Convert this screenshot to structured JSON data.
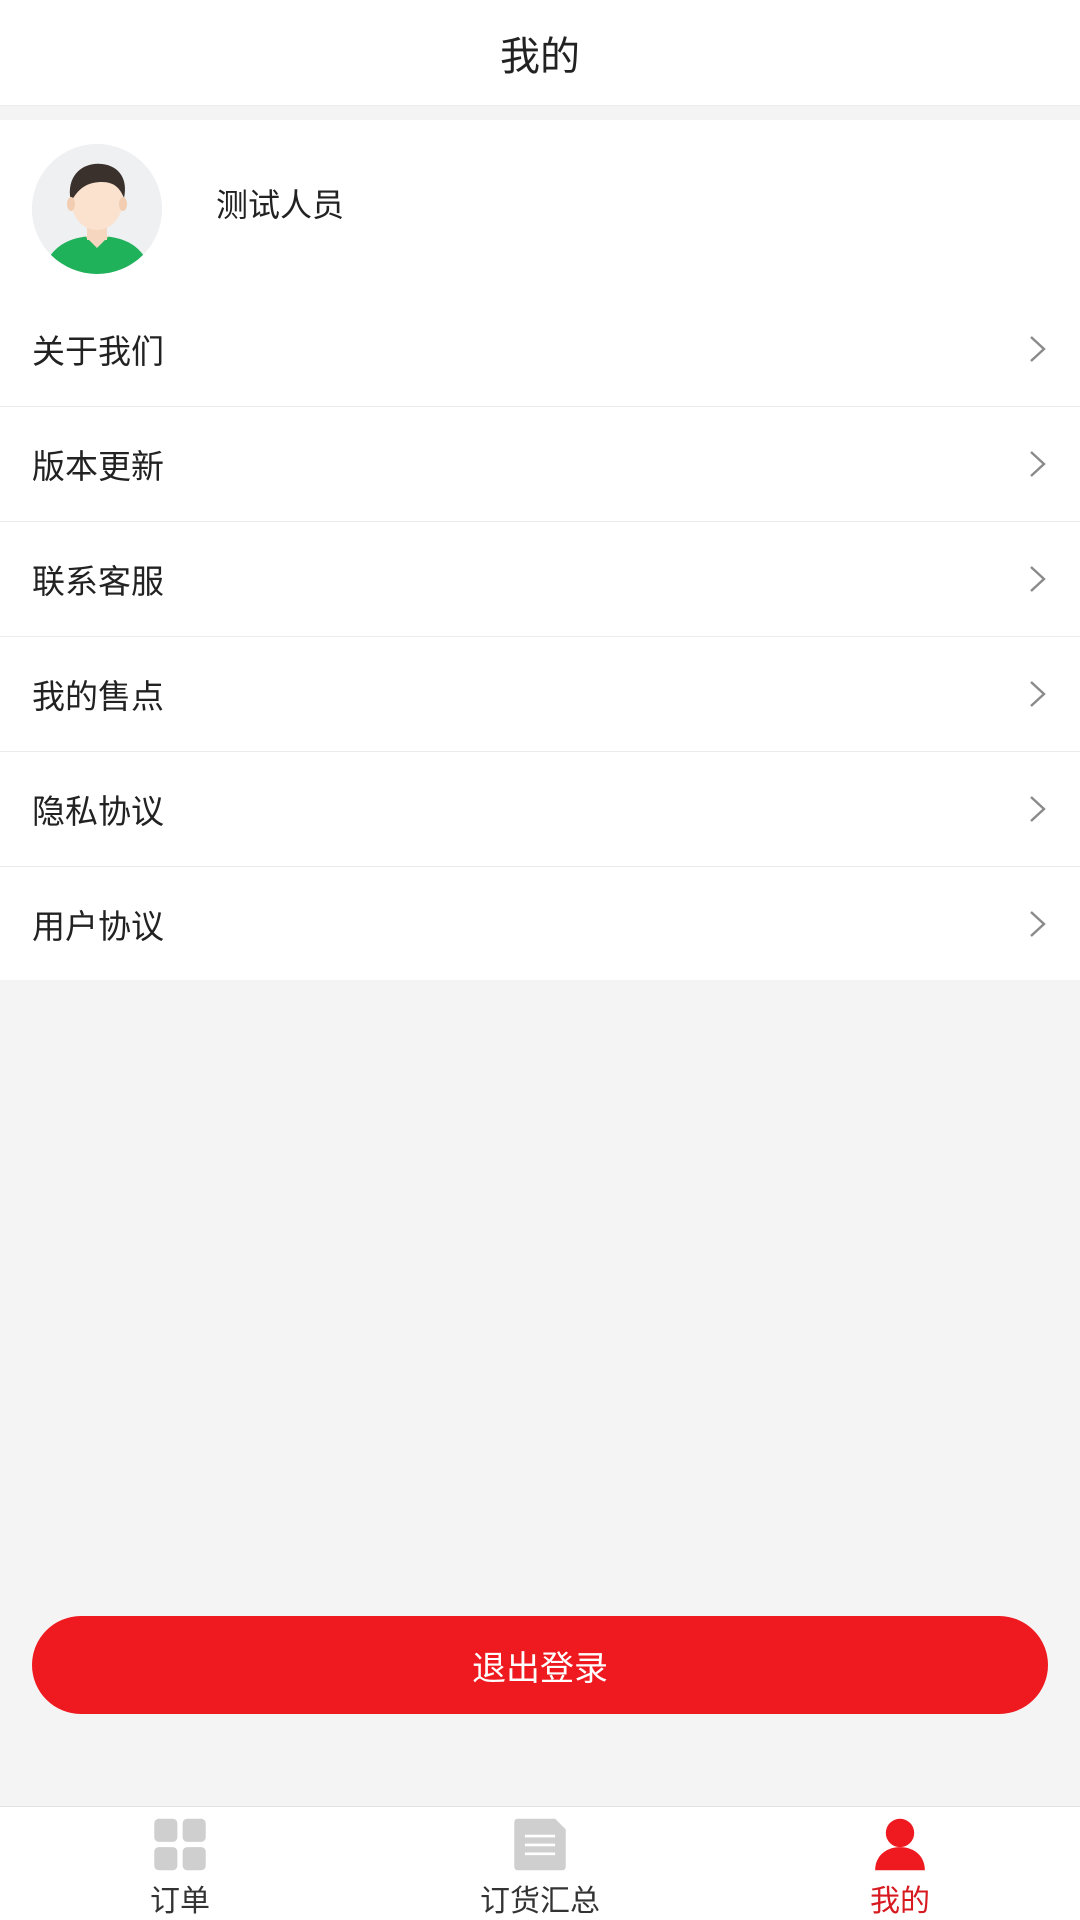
{
  "header": {
    "title": "我的"
  },
  "profile": {
    "name": "测试人员",
    "avatar_icon": "user-avatar-icon"
  },
  "menu": {
    "items": [
      {
        "label": "关于我们",
        "key": "about"
      },
      {
        "label": "版本更新",
        "key": "update"
      },
      {
        "label": "联系客服",
        "key": "support"
      },
      {
        "label": "我的售点",
        "key": "outlets"
      },
      {
        "label": "隐私协议",
        "key": "privacy"
      },
      {
        "label": "用户协议",
        "key": "terms"
      }
    ]
  },
  "logout": {
    "label": "退出登录"
  },
  "tabbar": {
    "tabs": [
      {
        "label": "订单",
        "icon": "grid-icon",
        "active": false
      },
      {
        "label": "订货汇总",
        "icon": "document-icon",
        "active": false
      },
      {
        "label": "我的",
        "icon": "person-icon",
        "active": true
      }
    ]
  },
  "colors": {
    "accent": "#ee1a1f",
    "active_tab": "#d71920",
    "background": "#f4f4f4"
  }
}
